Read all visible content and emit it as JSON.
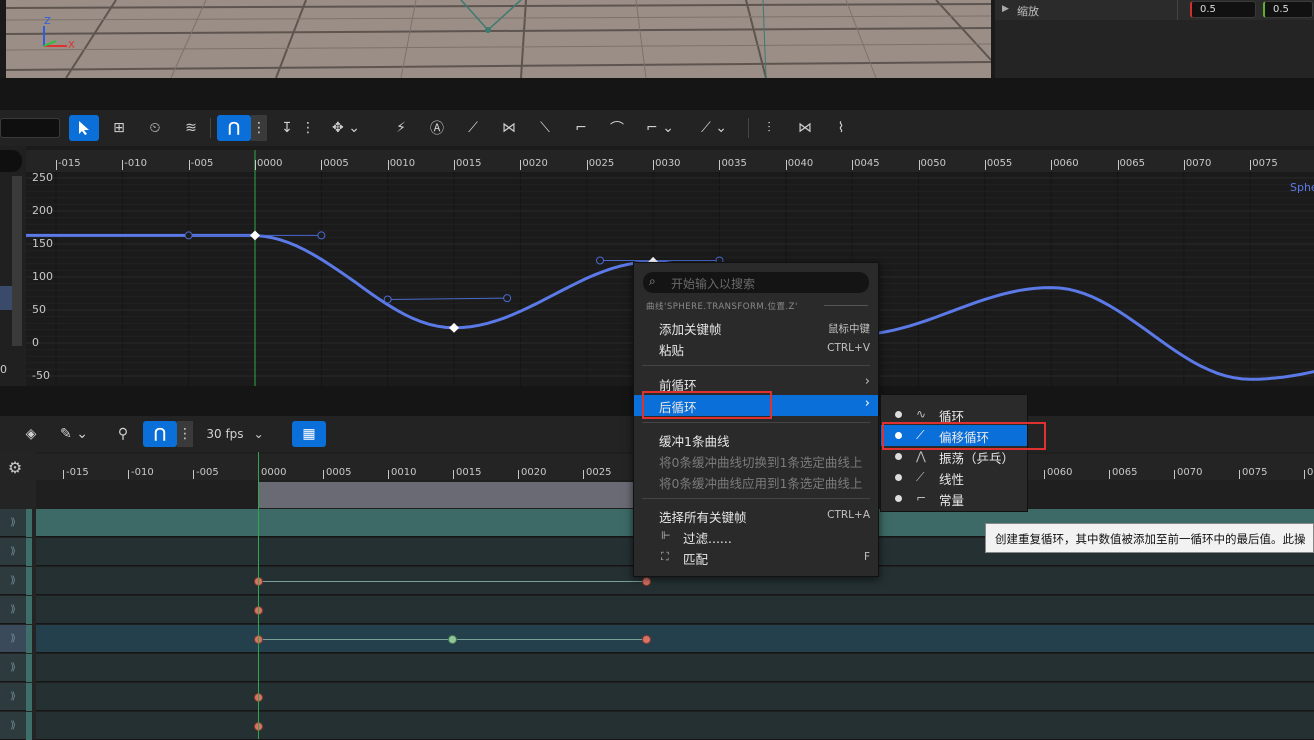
{
  "details_panel": {
    "scale_label": "缩放",
    "scale_x": "0.5",
    "scale_y": "0.5"
  },
  "viewport": {
    "axis_z": "Z",
    "axis_x": "X"
  },
  "curve_editor": {
    "ruler_labels": [
      "-015",
      "-010",
      "-005",
      "0000",
      "0005",
      "0010",
      "0015",
      "0020",
      "0025",
      "0030",
      "0035",
      "0040",
      "0045",
      "0050",
      "0055",
      "0060",
      "0065",
      "0070",
      "0075"
    ],
    "y_labels": [
      "250",
      "200",
      "150",
      "100",
      "50",
      "0",
      "-50"
    ],
    "left_value": "0",
    "curve_name_partial": "Sphe",
    "chart_data": {
      "type": "line",
      "x": [
        -15,
        0,
        15,
        30,
        45,
        60,
        75,
        90
      ],
      "values": [
        163,
        163,
        23,
        123,
        12,
        84,
        -55,
        -5
      ],
      "ylim": [
        -50,
        250
      ],
      "xlim": [
        -15,
        80
      ]
    }
  },
  "sequencer": {
    "fps_label": "30 fps",
    "ruler_labels": [
      "-015",
      "-010",
      "-005",
      "0000",
      "0005",
      "0010",
      "0015",
      "0020",
      "0025",
      "0060",
      "0065",
      "0070",
      "0075",
      "008"
    ]
  },
  "context_menu": {
    "search_placeholder": "开始输入以搜索",
    "section_title": "曲线'SPHERE.TRANSFORM.位置.Z'",
    "items": [
      {
        "label": "添加关键帧",
        "shortcut": "鼠标中键"
      },
      {
        "label": "粘贴",
        "shortcut": "CTRL+V"
      },
      {
        "label": "前循环",
        "shortcut": ""
      },
      {
        "label": "后循环",
        "shortcut": ""
      },
      {
        "label": "缓冲1条曲线",
        "shortcut": ""
      },
      {
        "label": "将0条缓冲曲线切换到1条选定曲线上",
        "shortcut": ""
      },
      {
        "label": "将0条缓冲曲线应用到1条选定曲线上",
        "shortcut": ""
      },
      {
        "label": "选择所有关键帧",
        "shortcut": "CTRL+A"
      },
      {
        "label": "过滤......",
        "shortcut": ""
      },
      {
        "label": "匹配",
        "shortcut": "F"
      }
    ]
  },
  "submenu": {
    "items": [
      {
        "label": "循环"
      },
      {
        "label": "偏移循环"
      },
      {
        "label": "振荡（乒乓）"
      },
      {
        "label": "线性"
      },
      {
        "label": "常量"
      }
    ]
  },
  "tooltip": {
    "text": "创建重复循环，其中数值被添加至前一循环中的最后值。此操"
  },
  "colors": {
    "accent": "#0a6fd8",
    "curve": "#5b7ae8",
    "highlight_box": "#e03030",
    "key_red": "#d67365",
    "key_green": "#8ec59a"
  }
}
